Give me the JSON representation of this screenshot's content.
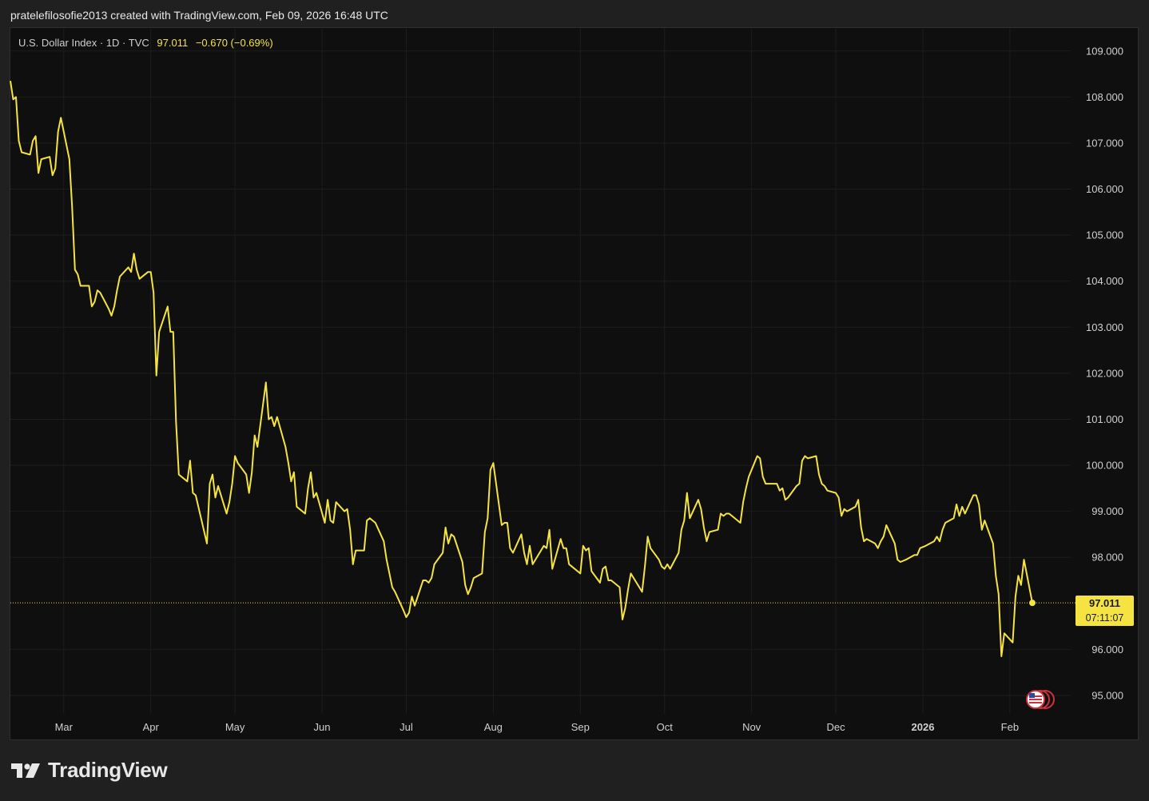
{
  "header": {
    "caption": "pratelefilosofie2013 created with TradingView.com, Feb 09, 2026 16:48 UTC"
  },
  "legend": {
    "symbol": "U.S. Dollar Index · 1D · TVC",
    "last": "97.011",
    "change": "−0.670 (−0.69%)"
  },
  "price_tag": {
    "price": "97.011",
    "countdown": "07:11:07"
  },
  "footer": {
    "brand": "TradingView"
  },
  "colors": {
    "line": "#f5e342",
    "background": "#0f0f0f",
    "grid": "#1d1d1d",
    "axis_text": "#d0d0d0"
  },
  "icons": {
    "flag": "us-flag-event-icon",
    "logo": "tradingview-logo-icon"
  },
  "chart_data": {
    "type": "line",
    "title": "U.S. Dollar Index",
    "xlabel": "",
    "ylabel": "",
    "ylim": [
      94.6,
      109.5
    ],
    "y_ticks": [
      "109.000",
      "108.000",
      "107.000",
      "106.000",
      "105.000",
      "104.000",
      "103.000",
      "102.000",
      "101.000",
      "100.000",
      "99.000",
      "98.000",
      "96.000",
      "95.000"
    ],
    "x_ticks": [
      {
        "label": "Mar",
        "date": "2025-03-01",
        "bold": false
      },
      {
        "label": "Apr",
        "date": "2025-04-01",
        "bold": false
      },
      {
        "label": "May",
        "date": "2025-05-01",
        "bold": false
      },
      {
        "label": "Jun",
        "date": "2025-06-01",
        "bold": false
      },
      {
        "label": "Jul",
        "date": "2025-07-01",
        "bold": false
      },
      {
        "label": "Aug",
        "date": "2025-08-01",
        "bold": false
      },
      {
        "label": "Sep",
        "date": "2025-09-01",
        "bold": false
      },
      {
        "label": "Oct",
        "date": "2025-10-01",
        "bold": false
      },
      {
        "label": "Nov",
        "date": "2025-11-01",
        "bold": false
      },
      {
        "label": "Dec",
        "date": "2025-12-01",
        "bold": false
      },
      {
        "label": "2026",
        "date": "2026-01-01",
        "bold": true
      },
      {
        "label": "Feb",
        "date": "2026-02-01",
        "bold": false
      }
    ],
    "last_value": 97.011,
    "grid": true,
    "series": [
      {
        "values": [
          [
            "2025-02-10",
            108.35
          ],
          [
            "2025-02-11",
            107.95
          ],
          [
            "2025-02-12",
            108.0
          ],
          [
            "2025-02-13",
            107.05
          ],
          [
            "2025-02-14",
            106.8
          ],
          [
            "2025-02-17",
            106.75
          ],
          [
            "2025-02-18",
            107.05
          ],
          [
            "2025-02-19",
            107.15
          ],
          [
            "2025-02-20",
            106.35
          ],
          [
            "2025-02-21",
            106.65
          ],
          [
            "2025-02-24",
            106.7
          ],
          [
            "2025-02-25",
            106.3
          ],
          [
            "2025-02-26",
            106.45
          ],
          [
            "2025-02-27",
            107.25
          ],
          [
            "2025-02-28",
            107.55
          ],
          [
            "2025-03-03",
            106.65
          ],
          [
            "2025-03-04",
            105.6
          ],
          [
            "2025-03-05",
            104.25
          ],
          [
            "2025-03-06",
            104.15
          ],
          [
            "2025-03-07",
            103.9
          ],
          [
            "2025-03-10",
            103.9
          ],
          [
            "2025-03-11",
            103.45
          ],
          [
            "2025-03-12",
            103.55
          ],
          [
            "2025-03-13",
            103.8
          ],
          [
            "2025-03-14",
            103.75
          ],
          [
            "2025-03-17",
            103.4
          ],
          [
            "2025-03-18",
            103.25
          ],
          [
            "2025-03-19",
            103.45
          ],
          [
            "2025-03-20",
            103.8
          ],
          [
            "2025-03-21",
            104.1
          ],
          [
            "2025-03-24",
            104.3
          ],
          [
            "2025-03-25",
            104.2
          ],
          [
            "2025-03-26",
            104.6
          ],
          [
            "2025-03-27",
            104.25
          ],
          [
            "2025-03-28",
            104.05
          ],
          [
            "2025-03-31",
            104.2
          ],
          [
            "2025-04-01",
            104.2
          ],
          [
            "2025-04-02",
            103.75
          ],
          [
            "2025-04-03",
            101.95
          ],
          [
            "2025-04-04",
            102.9
          ],
          [
            "2025-04-07",
            103.45
          ],
          [
            "2025-04-08",
            102.9
          ],
          [
            "2025-04-09",
            102.9
          ],
          [
            "2025-04-10",
            100.95
          ],
          [
            "2025-04-11",
            99.8
          ],
          [
            "2025-04-14",
            99.65
          ],
          [
            "2025-04-15",
            100.1
          ],
          [
            "2025-04-16",
            99.4
          ],
          [
            "2025-04-17",
            99.35
          ],
          [
            "2025-04-21",
            98.3
          ],
          [
            "2025-04-22",
            99.6
          ],
          [
            "2025-04-23",
            99.8
          ],
          [
            "2025-04-24",
            99.3
          ],
          [
            "2025-04-25",
            99.55
          ],
          [
            "2025-04-28",
            98.95
          ],
          [
            "2025-04-29",
            99.2
          ],
          [
            "2025-04-30",
            99.6
          ],
          [
            "2025-05-01",
            100.2
          ],
          [
            "2025-05-02",
            100.05
          ],
          [
            "2025-05-05",
            99.8
          ],
          [
            "2025-05-06",
            99.4
          ],
          [
            "2025-05-07",
            99.85
          ],
          [
            "2025-05-08",
            100.65
          ],
          [
            "2025-05-09",
            100.4
          ],
          [
            "2025-05-12",
            101.8
          ],
          [
            "2025-05-13",
            101.0
          ],
          [
            "2025-05-14",
            101.05
          ],
          [
            "2025-05-15",
            100.85
          ],
          [
            "2025-05-16",
            101.05
          ],
          [
            "2025-05-19",
            100.4
          ],
          [
            "2025-05-20",
            100.05
          ],
          [
            "2025-05-21",
            99.65
          ],
          [
            "2025-05-22",
            99.85
          ],
          [
            "2025-05-23",
            99.1
          ],
          [
            "2025-05-26",
            98.95
          ],
          [
            "2025-05-27",
            99.5
          ],
          [
            "2025-05-28",
            99.85
          ],
          [
            "2025-05-29",
            99.3
          ],
          [
            "2025-05-30",
            99.4
          ],
          [
            "2025-06-02",
            98.75
          ],
          [
            "2025-06-03",
            99.25
          ],
          [
            "2025-06-04",
            98.8
          ],
          [
            "2025-06-05",
            98.75
          ],
          [
            "2025-06-06",
            99.2
          ],
          [
            "2025-06-09",
            99.0
          ],
          [
            "2025-06-10",
            99.05
          ],
          [
            "2025-06-11",
            98.6
          ],
          [
            "2025-06-12",
            97.85
          ],
          [
            "2025-06-13",
            98.15
          ],
          [
            "2025-06-16",
            98.15
          ],
          [
            "2025-06-17",
            98.8
          ],
          [
            "2025-06-18",
            98.85
          ],
          [
            "2025-06-19",
            98.8
          ],
          [
            "2025-06-20",
            98.75
          ],
          [
            "2025-06-23",
            98.35
          ],
          [
            "2025-06-24",
            97.95
          ],
          [
            "2025-06-25",
            97.65
          ],
          [
            "2025-06-26",
            97.35
          ],
          [
            "2025-06-27",
            97.25
          ],
          [
            "2025-06-30",
            96.85
          ],
          [
            "2025-07-01",
            96.7
          ],
          [
            "2025-07-02",
            96.8
          ],
          [
            "2025-07-03",
            97.15
          ],
          [
            "2025-07-04",
            96.95
          ],
          [
            "2025-07-07",
            97.5
          ],
          [
            "2025-07-08",
            97.5
          ],
          [
            "2025-07-09",
            97.45
          ],
          [
            "2025-07-10",
            97.55
          ],
          [
            "2025-07-11",
            97.85
          ],
          [
            "2025-07-14",
            98.1
          ],
          [
            "2025-07-15",
            98.65
          ],
          [
            "2025-07-16",
            98.3
          ],
          [
            "2025-07-17",
            98.5
          ],
          [
            "2025-07-18",
            98.45
          ],
          [
            "2025-07-21",
            97.9
          ],
          [
            "2025-07-22",
            97.4
          ],
          [
            "2025-07-23",
            97.2
          ],
          [
            "2025-07-24",
            97.35
          ],
          [
            "2025-07-25",
            97.55
          ],
          [
            "2025-07-28",
            97.65
          ],
          [
            "2025-07-29",
            98.55
          ],
          [
            "2025-07-30",
            98.85
          ],
          [
            "2025-07-31",
            99.9
          ],
          [
            "2025-08-01",
            100.05
          ],
          [
            "2025-08-04",
            98.7
          ],
          [
            "2025-08-05",
            98.75
          ],
          [
            "2025-08-06",
            98.75
          ],
          [
            "2025-08-07",
            98.2
          ],
          [
            "2025-08-08",
            98.1
          ],
          [
            "2025-08-11",
            98.5
          ],
          [
            "2025-08-12",
            98.1
          ],
          [
            "2025-08-13",
            97.85
          ],
          [
            "2025-08-14",
            98.25
          ],
          [
            "2025-08-15",
            97.85
          ],
          [
            "2025-08-18",
            98.15
          ],
          [
            "2025-08-19",
            98.25
          ],
          [
            "2025-08-20",
            98.2
          ],
          [
            "2025-08-21",
            98.6
          ],
          [
            "2025-08-22",
            97.75
          ],
          [
            "2025-08-25",
            98.4
          ],
          [
            "2025-08-26",
            98.2
          ],
          [
            "2025-08-27",
            98.2
          ],
          [
            "2025-08-28",
            97.85
          ],
          [
            "2025-08-29",
            97.8
          ],
          [
            "2025-09-01",
            97.65
          ],
          [
            "2025-09-02",
            98.25
          ],
          [
            "2025-09-03",
            98.15
          ],
          [
            "2025-09-04",
            98.2
          ],
          [
            "2025-09-05",
            97.7
          ],
          [
            "2025-09-08",
            97.45
          ],
          [
            "2025-09-09",
            97.75
          ],
          [
            "2025-09-10",
            97.8
          ],
          [
            "2025-09-11",
            97.5
          ],
          [
            "2025-09-12",
            97.5
          ],
          [
            "2025-09-15",
            97.35
          ],
          [
            "2025-09-16",
            96.65
          ],
          [
            "2025-09-17",
            96.9
          ],
          [
            "2025-09-18",
            97.3
          ],
          [
            "2025-09-19",
            97.65
          ],
          [
            "2025-09-22",
            97.35
          ],
          [
            "2025-09-23",
            97.25
          ],
          [
            "2025-09-24",
            97.8
          ],
          [
            "2025-09-25",
            98.45
          ],
          [
            "2025-09-26",
            98.2
          ],
          [
            "2025-09-29",
            97.95
          ],
          [
            "2025-09-30",
            97.8
          ],
          [
            "2025-10-01",
            97.75
          ],
          [
            "2025-10-02",
            97.85
          ],
          [
            "2025-10-03",
            97.75
          ],
          [
            "2025-10-06",
            98.1
          ],
          [
            "2025-10-07",
            98.6
          ],
          [
            "2025-10-08",
            98.8
          ],
          [
            "2025-10-09",
            99.4
          ],
          [
            "2025-10-10",
            98.85
          ],
          [
            "2025-10-13",
            99.25
          ],
          [
            "2025-10-14",
            99.05
          ],
          [
            "2025-10-15",
            98.65
          ],
          [
            "2025-10-16",
            98.35
          ],
          [
            "2025-10-17",
            98.55
          ],
          [
            "2025-10-20",
            98.6
          ],
          [
            "2025-10-21",
            98.95
          ],
          [
            "2025-10-22",
            98.9
          ],
          [
            "2025-10-23",
            98.95
          ],
          [
            "2025-10-24",
            98.95
          ],
          [
            "2025-10-27",
            98.8
          ],
          [
            "2025-10-28",
            98.75
          ],
          [
            "2025-10-29",
            99.2
          ],
          [
            "2025-10-30",
            99.5
          ],
          [
            "2025-10-31",
            99.75
          ],
          [
            "2025-11-03",
            100.2
          ],
          [
            "2025-11-04",
            100.15
          ],
          [
            "2025-11-05",
            99.75
          ],
          [
            "2025-11-06",
            99.6
          ],
          [
            "2025-11-07",
            99.6
          ],
          [
            "2025-11-10",
            99.6
          ],
          [
            "2025-11-11",
            99.45
          ],
          [
            "2025-11-12",
            99.5
          ],
          [
            "2025-11-13",
            99.25
          ],
          [
            "2025-11-14",
            99.3
          ],
          [
            "2025-11-17",
            99.55
          ],
          [
            "2025-11-18",
            99.6
          ],
          [
            "2025-11-19",
            100.1
          ],
          [
            "2025-11-20",
            100.2
          ],
          [
            "2025-11-21",
            100.15
          ],
          [
            "2025-11-24",
            100.2
          ],
          [
            "2025-11-25",
            99.8
          ],
          [
            "2025-11-26",
            99.6
          ],
          [
            "2025-11-27",
            99.55
          ],
          [
            "2025-11-28",
            99.45
          ],
          [
            "2025-12-01",
            99.4
          ],
          [
            "2025-12-02",
            99.3
          ],
          [
            "2025-12-03",
            98.9
          ],
          [
            "2025-12-04",
            99.05
          ],
          [
            "2025-12-05",
            99.0
          ],
          [
            "2025-12-08",
            99.1
          ],
          [
            "2025-12-09",
            99.25
          ],
          [
            "2025-12-10",
            98.65
          ],
          [
            "2025-12-11",
            98.35
          ],
          [
            "2025-12-12",
            98.4
          ],
          [
            "2025-12-15",
            98.3
          ],
          [
            "2025-12-16",
            98.2
          ],
          [
            "2025-12-17",
            98.35
          ],
          [
            "2025-12-18",
            98.45
          ],
          [
            "2025-12-19",
            98.7
          ],
          [
            "2025-12-22",
            98.3
          ],
          [
            "2025-12-23",
            97.95
          ],
          [
            "2025-12-24",
            97.9
          ],
          [
            "2025-12-26",
            97.95
          ],
          [
            "2025-12-29",
            98.05
          ],
          [
            "2025-12-30",
            98.05
          ],
          [
            "2025-12-31",
            98.2
          ],
          [
            "2026-01-02",
            98.25
          ],
          [
            "2026-01-05",
            98.35
          ],
          [
            "2026-01-06",
            98.45
          ],
          [
            "2026-01-07",
            98.35
          ],
          [
            "2026-01-08",
            98.6
          ],
          [
            "2026-01-09",
            98.75
          ],
          [
            "2026-01-12",
            98.85
          ],
          [
            "2026-01-13",
            99.15
          ],
          [
            "2026-01-14",
            98.9
          ],
          [
            "2026-01-15",
            99.1
          ],
          [
            "2026-01-16",
            98.95
          ],
          [
            "2026-01-19",
            99.35
          ],
          [
            "2026-01-20",
            99.35
          ],
          [
            "2026-01-21",
            99.15
          ],
          [
            "2026-01-22",
            98.6
          ],
          [
            "2026-01-23",
            98.8
          ],
          [
            "2026-01-26",
            98.3
          ],
          [
            "2026-01-27",
            97.6
          ],
          [
            "2026-01-28",
            97.2
          ],
          [
            "2026-01-29",
            95.85
          ],
          [
            "2026-01-30",
            96.35
          ],
          [
            "2026-02-02",
            96.15
          ],
          [
            "2026-02-03",
            97.15
          ],
          [
            "2026-02-04",
            97.6
          ],
          [
            "2026-02-05",
            97.4
          ],
          [
            "2026-02-06",
            97.95
          ],
          [
            "2026-02-09",
            97.011
          ]
        ]
      }
    ]
  }
}
